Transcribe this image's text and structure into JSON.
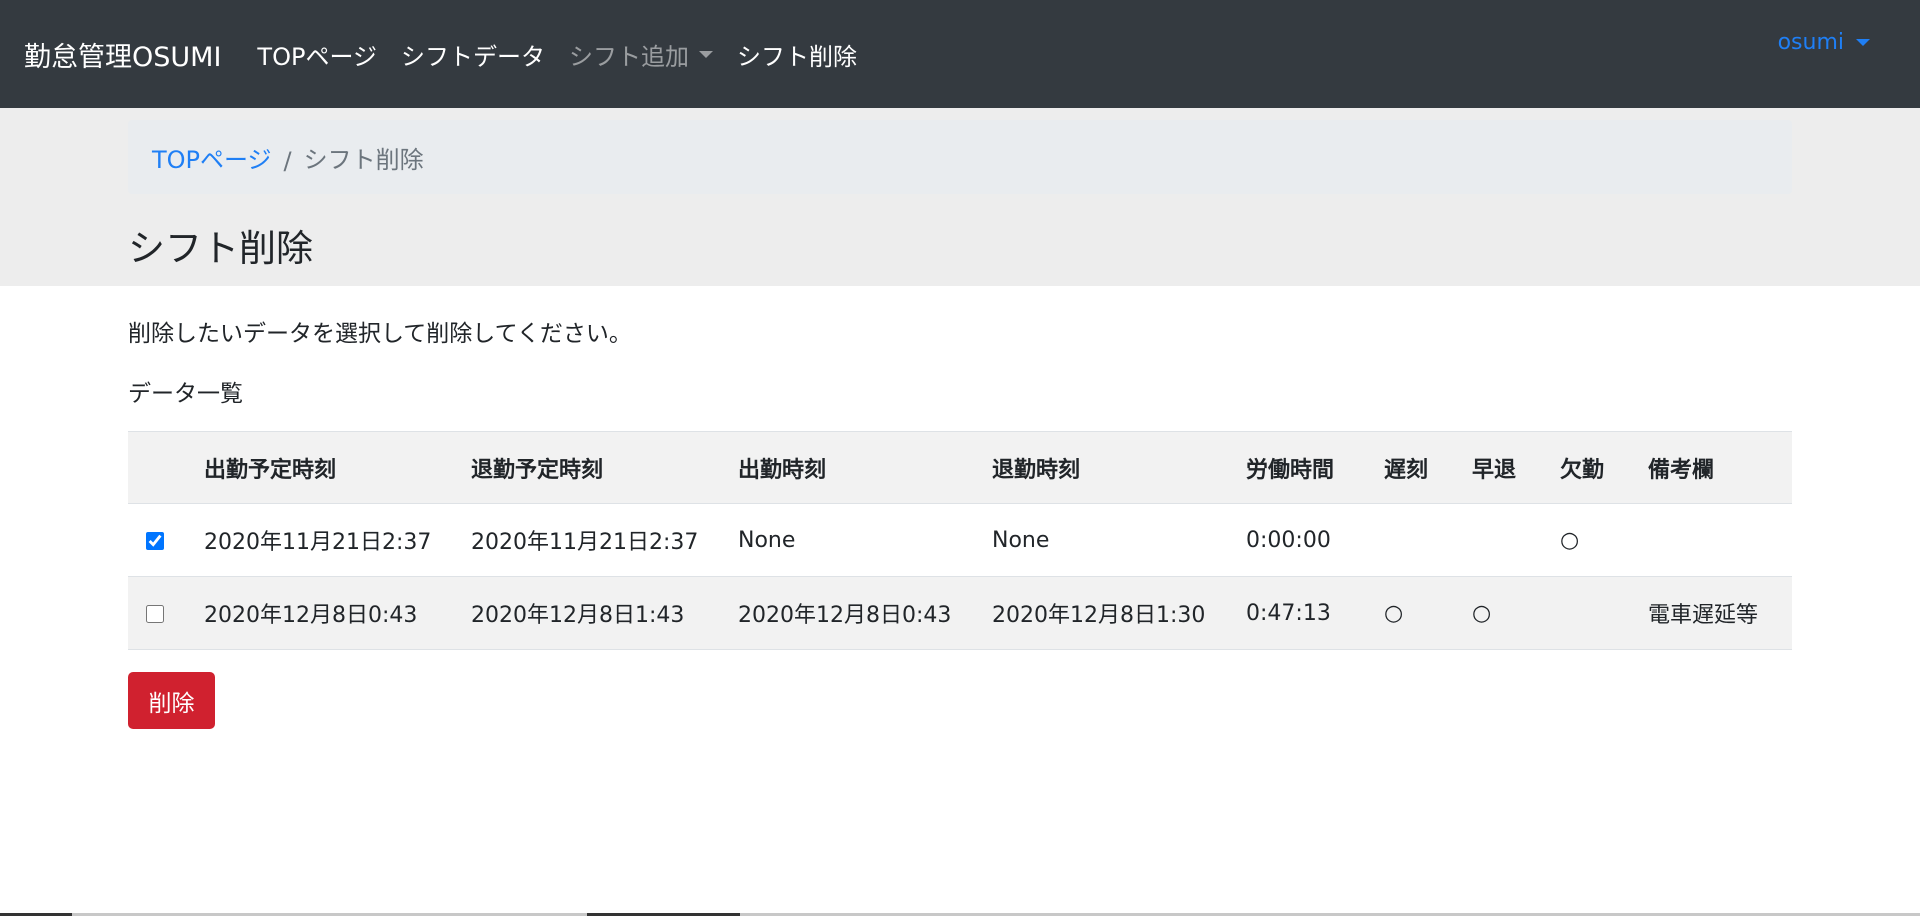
{
  "navbar": {
    "brand": "勤怠管理OSUMI",
    "links": [
      {
        "label": "TOPページ"
      },
      {
        "label": "シフトデータ"
      },
      {
        "label": "シフト追加"
      },
      {
        "label": "シフト削除"
      }
    ],
    "user": "osumi"
  },
  "breadcrumb": {
    "home": "TOPページ",
    "separator": "/",
    "current": "シフト削除"
  },
  "page": {
    "title": "シフト削除",
    "instruction": "削除したいデータを選択して削除してください。",
    "list_label": "データ一覧"
  },
  "table": {
    "headers": [
      "",
      "出勤予定時刻",
      "退勤予定時刻",
      "出勤時刻",
      "退勤時刻",
      "労働時間",
      "遅刻",
      "早退",
      "欠勤",
      "備考欄"
    ],
    "rows": [
      {
        "checked": true,
        "cells": [
          "2020年11月21日2:37",
          "2020年11月21日2:37",
          "None",
          "None",
          "0:00:00",
          "",
          "",
          "○",
          ""
        ]
      },
      {
        "checked": false,
        "cells": [
          "2020年12月8日0:43",
          "2020年12月8日1:43",
          "2020年12月8日0:43",
          "2020年12月8日1:30",
          "0:47:13",
          "○",
          "○",
          "",
          "電車遅延等"
        ]
      }
    ]
  },
  "actions": {
    "delete_label": "削除"
  },
  "colors": {
    "navbar_bg": "#343a40",
    "link_blue": "#1f7ff5",
    "delete_red": "#d0212f",
    "header_bg": "#ededed"
  }
}
